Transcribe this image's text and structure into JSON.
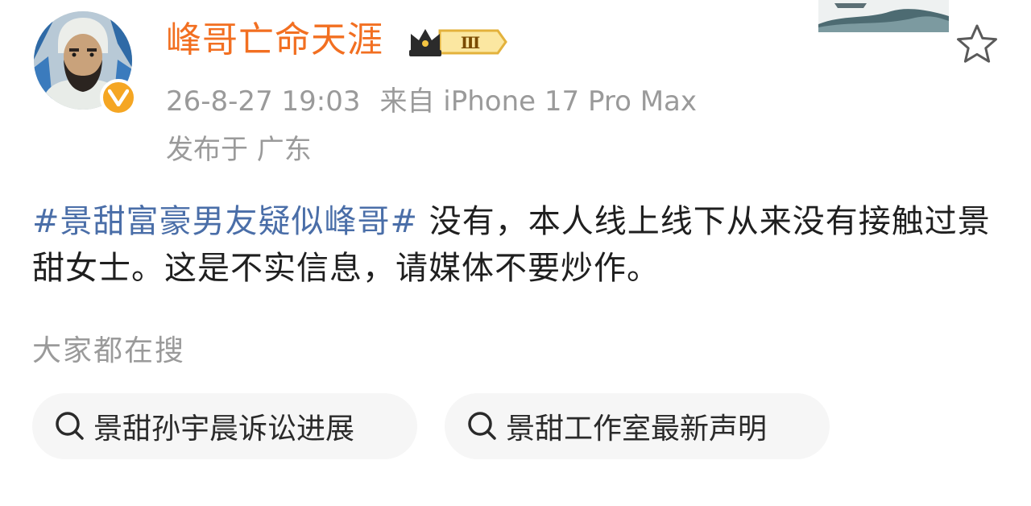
{
  "post": {
    "author": {
      "name": "峰哥亡命天涯",
      "vip_level": "Ⅲ"
    },
    "timestamp": "26-8-27 19:03",
    "source": "来自 iPhone 17 Pro Max",
    "location": "发布于 广东",
    "hashtag": "#景甜富豪男友疑似峰哥#",
    "body": " 没有，本人线上线下从来没有接触过景甜女士。这是不实信息，请媒体不要炒作。"
  },
  "related_search": {
    "heading": "大家都在搜",
    "items": [
      {
        "label": "景甜孙宇晨诉讼进展"
      },
      {
        "label": "景甜工作室最新声明"
      }
    ]
  },
  "colors": {
    "username": "#f26f21",
    "hashtag": "#4a6ea8",
    "meta": "#9a9a9a",
    "chip_bg": "#f6f6f6",
    "verified": "#f5a623"
  },
  "icons": {
    "favorite": "star-outline-icon",
    "search": "search-icon",
    "verified": "verified-v-icon",
    "vip": "crown-icon"
  }
}
